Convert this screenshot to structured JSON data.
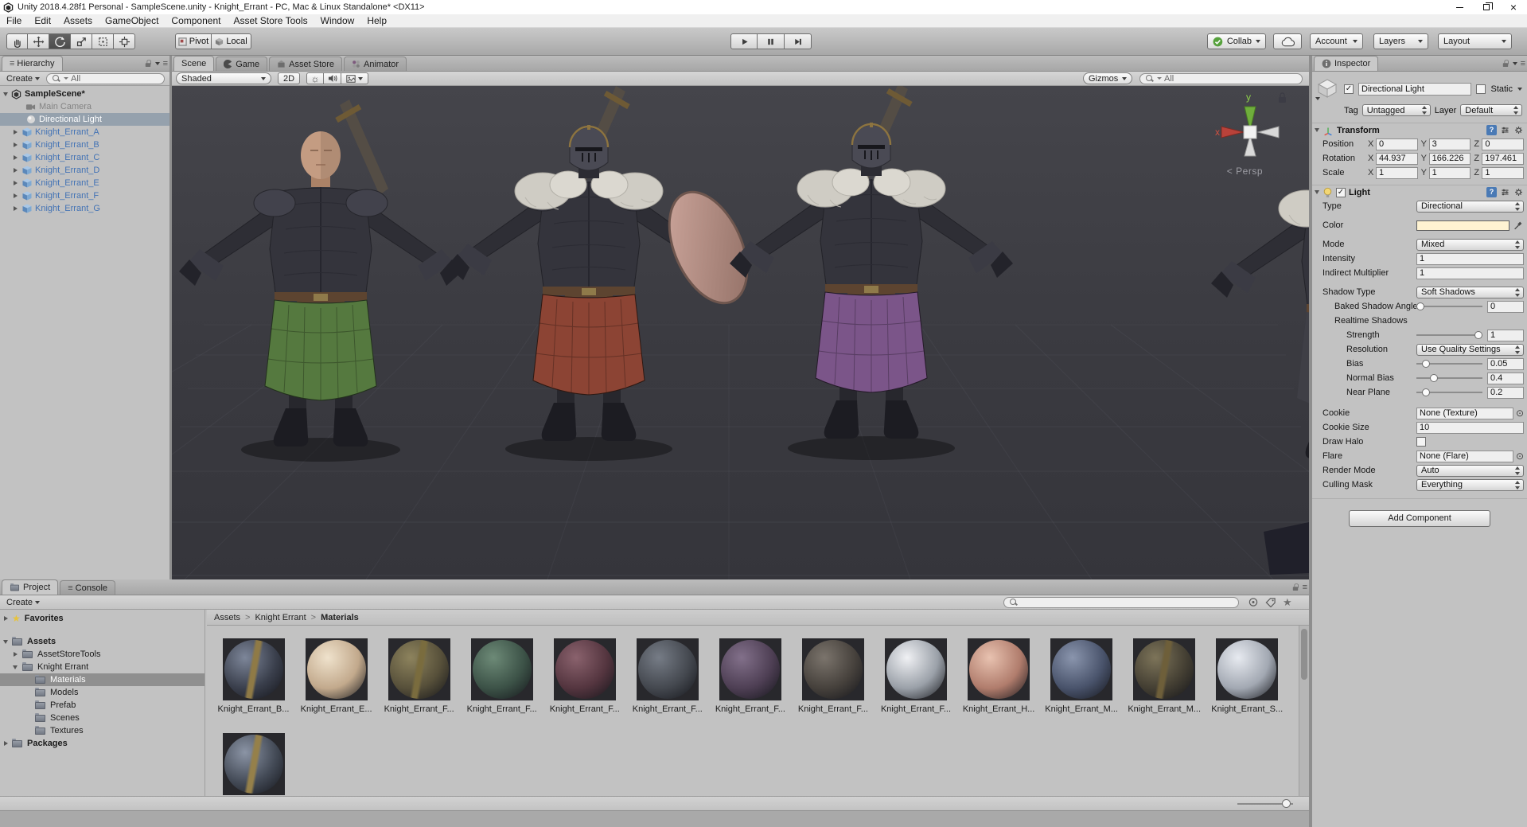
{
  "icons": {
    "close": "×",
    "check": "✓",
    "star": "★",
    "menu": "≡",
    "question": "?",
    "target": "⊙",
    "sun": "☼",
    "chev": ">",
    "persp_chev": "<"
  },
  "window": {
    "title": "Unity 2018.4.28f1 Personal - SampleScene.unity - Knight_Errant - PC, Mac & Linux Standalone* <DX11>"
  },
  "menubar": {
    "items": [
      "File",
      "Edit",
      "Assets",
      "GameObject",
      "Component",
      "Asset Store Tools",
      "Window",
      "Help"
    ]
  },
  "toolbar": {
    "pivot": "Pivot",
    "local": "Local",
    "collab": "Collab",
    "account": "Account",
    "layers": "Layers",
    "layout": "Layout"
  },
  "hierarchy": {
    "tab": "Hierarchy",
    "create": "Create",
    "search": "All",
    "items": [
      {
        "label": "SampleScene*"
      },
      {
        "label": "Main Camera"
      },
      {
        "label": "Directional Light"
      },
      {
        "label": "Knight_Errant_A"
      },
      {
        "label": "Knight_Errant_B"
      },
      {
        "label": "Knight_Errant_C"
      },
      {
        "label": "Knight_Errant_D"
      },
      {
        "label": "Knight_Errant_E"
      },
      {
        "label": "Knight_Errant_F"
      },
      {
        "label": "Knight_Errant_G"
      }
    ]
  },
  "scene_view": {
    "tabs": [
      "Scene",
      "Game",
      "Asset Store",
      "Animator"
    ],
    "shading": "Shaded",
    "d2": "2D",
    "gizmos": "Gizmos",
    "search": "All",
    "axis_x": "x",
    "axis_y": "y",
    "persp": "Persp",
    "knights": [
      {
        "skirt": "#55793f"
      },
      {
        "skirt": "#8c4434"
      },
      {
        "skirt": "#7b5589"
      },
      {
        "skirt": "#3f3f46"
      }
    ]
  },
  "inspector": {
    "tab": "Inspector",
    "name": "Directional Light",
    "static_label": "Static",
    "tag_label": "Tag",
    "tag": "Untagged",
    "layer_label": "Layer",
    "layer": "Default",
    "transform": {
      "title": "Transform",
      "axis": {
        "x": "X",
        "y": "Y",
        "z": "Z"
      },
      "rows": [
        {
          "label": "Position",
          "x": "0",
          "y": "3",
          "z": "0"
        },
        {
          "label": "Rotation",
          "x": "44.937",
          "y": "166.226",
          "z": "197.461"
        },
        {
          "label": "Scale",
          "x": "1",
          "y": "1",
          "z": "1"
        }
      ]
    },
    "light": {
      "title": "Light",
      "type_label": "Type",
      "type": "Directional",
      "color_label": "Color",
      "color": "#fff3d2",
      "mode_label": "Mode",
      "mode": "Mixed",
      "intensity_label": "Intensity",
      "intensity": "1",
      "indirect_label": "Indirect Multiplier",
      "indirect": "1",
      "shadow_type_label": "Shadow Type",
      "shadow_type": "Soft Shadows",
      "baked_label": "Baked Shadow Angle",
      "baked": "0",
      "realtime_label": "Realtime Shadows",
      "strength_label": "Strength",
      "strength": "1",
      "resolution_label": "Resolution",
      "resolution": "Use Quality Settings",
      "bias_label": "Bias",
      "bias": "0.05",
      "normal_bias_label": "Normal Bias",
      "normal_bias": "0.4",
      "near_plane_label": "Near Plane",
      "near_plane": "0.2",
      "cookie_label": "Cookie",
      "cookie": "None (Texture)",
      "cookie_size_label": "Cookie Size",
      "cookie_size": "10",
      "draw_halo_label": "Draw Halo",
      "flare_label": "Flare",
      "flare": "None (Flare)",
      "render_mode_label": "Render Mode",
      "render_mode": "Auto",
      "culling_label": "Culling Mask",
      "culling": "Everything"
    },
    "add_component": "Add Component"
  },
  "project": {
    "tabs": [
      "Project",
      "Console"
    ],
    "create": "Create",
    "breadcrumb": [
      "Assets",
      "Knight Errant",
      "Materials"
    ],
    "tree": [
      "Favorites",
      "Assets",
      "AssetStoreTools",
      "Knight Errant",
      "Materials",
      "Models",
      "Prefab",
      "Scenes",
      "Textures",
      "Packages"
    ],
    "materials": [
      {
        "label": "Knight_Errant_B...",
        "hi": "#7d8699",
        "base": "#3a3f4c",
        "stripe": "#8f7a46"
      },
      {
        "label": "Knight_Errant_E...",
        "hi": "#efe2cc",
        "base": "#c2a98c",
        "stripe": null
      },
      {
        "label": "Knight_Errant_F...",
        "hi": "#8d835d",
        "base": "#57503a",
        "stripe": "#7a6c3e"
      },
      {
        "label": "Knight_Errant_F...",
        "hi": "#6d8a77",
        "base": "#3c5247",
        "stripe": null
      },
      {
        "label": "Knight_Errant_F...",
        "hi": "#8a626d",
        "base": "#54353f",
        "stripe": null
      },
      {
        "label": "Knight_Errant_F...",
        "hi": "#767c86",
        "base": "#44484f",
        "stripe": null
      },
      {
        "label": "Knight_Errant_F...",
        "hi": "#82708a",
        "base": "#4e3f54",
        "stripe": null
      },
      {
        "label": "Knight_Errant_F...",
        "hi": "#7b746c",
        "base": "#46413c",
        "stripe": null
      },
      {
        "label": "Knight_Errant_F...",
        "hi": "#f0f1f4",
        "base": "#9aa0a8",
        "stripe": null
      },
      {
        "label": "Knight_Errant_H...",
        "hi": "#e8c2b0",
        "base": "#b07c6c",
        "stripe": null
      },
      {
        "label": "Knight_Errant_M...",
        "hi": "#8a95ad",
        "base": "#49536b",
        "stripe": null
      },
      {
        "label": "Knight_Errant_M...",
        "hi": "#7d7459",
        "base": "#443f33",
        "stripe": "#6e5f3a"
      },
      {
        "label": "Knight_Errant_S...",
        "hi": "#e7eaf0",
        "base": "#a2a8b2",
        "stripe": null
      },
      {
        "label": "",
        "hi": "#8b94a5",
        "base": "#434a56",
        "stripe": "#95804a"
      }
    ]
  }
}
